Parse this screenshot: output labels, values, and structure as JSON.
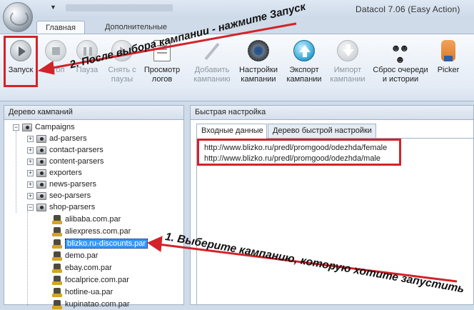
{
  "window": {
    "title": "Datacol 7.06 (Easy Action)"
  },
  "ribbon_tabs": [
    "Главная",
    "Дополнительные"
  ],
  "toolbar": [
    {
      "label": "Запуск",
      "icon": "play-icon",
      "enabled": true
    },
    {
      "label": "Стоп",
      "icon": "stop-icon",
      "enabled": false
    },
    {
      "label": "Пауза",
      "icon": "pause-icon",
      "enabled": false
    },
    {
      "label": "Снять с\nпаузы",
      "icon": "resume-icon",
      "enabled": false
    },
    {
      "label": "Просмотр\nлогов",
      "icon": "log-icon",
      "enabled": true
    },
    {
      "label": "Добавить\nкампанию",
      "icon": "magic-wand-icon",
      "enabled": false
    },
    {
      "label": "Настройки\nкампании",
      "icon": "gears-icon",
      "enabled": true
    },
    {
      "label": "Экспорт\nкампании",
      "icon": "export-arrow-icon",
      "enabled": true
    },
    {
      "label": "Импорт\nкампании",
      "icon": "import-arrow-icon",
      "enabled": false
    },
    {
      "label": "Сброс очереди\nи истории",
      "icon": "reset-people-icon",
      "enabled": true
    },
    {
      "label": "Picker",
      "icon": "picker-hand-icon",
      "enabled": true
    }
  ],
  "annotations": {
    "step2": "2. После выбора кампании - нажмите Запуск",
    "step1": "1. Выберите кампанию, которую хотите запустить"
  },
  "left_panel": {
    "title": "Дерево кампаний",
    "root": "Campaigns",
    "folders": [
      "ad-parsers",
      "contact-parsers",
      "content-parsers",
      "exporters",
      "news-parsers",
      "seo-parsers",
      "shop-parsers"
    ],
    "shop_items": [
      "alibaba.com.par",
      "aliexpress.com.par",
      "blizko.ru-discounts.par",
      "demo.par",
      "ebay.com.par",
      "focalprice.com.par",
      "hotline-ua.par",
      "kupinatao.com.par"
    ],
    "selected": "blizko.ru-discounts.par"
  },
  "right_panel": {
    "title": "Быстрая настройка",
    "tabs": [
      "Входные данные",
      "Дерево быстрой настройки"
    ],
    "urls": [
      "http://www.blizko.ru/predl/promgood/odezhda/female",
      "http://www.blizko.ru/predl/promgood/odezhda/male"
    ]
  },
  "colors": {
    "annotation_red": "#d2232a",
    "selection": "#3399ff"
  }
}
